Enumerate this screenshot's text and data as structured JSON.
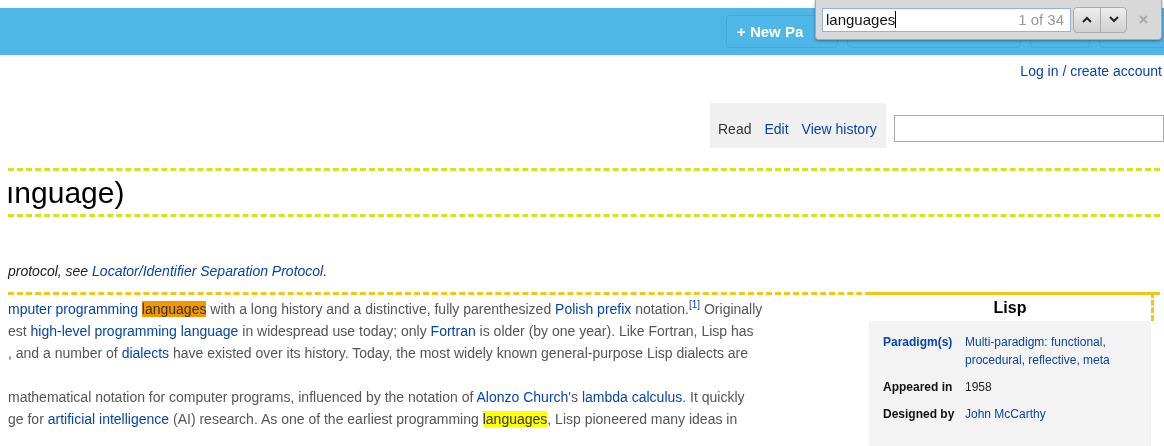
{
  "toolbar": {
    "new_button": "+ New Pa"
  },
  "find_bar": {
    "query": "languages",
    "count": "1 of 34"
  },
  "login_link": "Log in / create account",
  "view_tabs": [
    {
      "label": "Read",
      "selected": true
    },
    {
      "label": "Edit",
      "selected": false
    },
    {
      "label": "View history",
      "selected": false
    }
  ],
  "title": "ınguage)",
  "hatnote": [
    {
      "kind": "text",
      "text": "protocol, see "
    },
    {
      "kind": "link",
      "text": "Locator/Identifier Separation Protocol"
    },
    {
      "kind": "text",
      "text": "."
    }
  ],
  "paragraphs": [
    [
      [
        {
          "kind": "link",
          "text": "mputer programming "
        },
        {
          "kind": "current_match",
          "text": "languages"
        },
        {
          "kind": "text",
          "text": " with a long history and a distinctive, fully parenthesized "
        },
        {
          "kind": "link",
          "text": "Polish prefix"
        },
        {
          "kind": "text",
          "text": " notation."
        },
        {
          "kind": "ref",
          "text": "[1]"
        },
        {
          "kind": "text",
          "text": " Originally"
        }
      ],
      [
        {
          "kind": "text",
          "text": "est "
        },
        {
          "kind": "link",
          "text": "high-level programming language"
        },
        {
          "kind": "text",
          "text": " in widespread use today; only "
        },
        {
          "kind": "link",
          "text": "Fortran"
        },
        {
          "kind": "text",
          "text": " is older (by one year). Like Fortran, Lisp has"
        }
      ],
      [
        {
          "kind": "text",
          "text": ", and a number of "
        },
        {
          "kind": "link",
          "text": "dialects"
        },
        {
          "kind": "text",
          "text": " have existed over its history. Today, the most widely known general-purpose Lisp dialects are"
        }
      ]
    ],
    [
      [
        {
          "kind": "text",
          "text": "mathematical notation for computer programs, influenced by the notation of "
        },
        {
          "kind": "link",
          "text": "Alonzo Church"
        },
        {
          "kind": "text",
          "text": "'s "
        },
        {
          "kind": "link",
          "text": "lambda calculus"
        },
        {
          "kind": "text",
          "text": ". It quickly"
        }
      ],
      [
        {
          "kind": "text",
          "text": "ge for "
        },
        {
          "kind": "link",
          "text": "artificial intelligence"
        },
        {
          "kind": "text",
          "text": " (AI) research. As one of the earliest programming "
        },
        {
          "kind": "match",
          "text": "languages"
        },
        {
          "kind": "text",
          "text": ", Lisp pioneered many ideas in"
        }
      ]
    ]
  ],
  "infobox": {
    "title": "Lisp",
    "rows": [
      {
        "label": "Paradigm(s)",
        "label_link": true,
        "value": "Multi-paradigm: functional, procedural, reflective, meta",
        "value_link": true
      },
      {
        "label": "Appeared in",
        "label_link": false,
        "value": "1958",
        "value_link": false
      },
      {
        "label": "Designed by",
        "label_link": false,
        "value": "John McCarthy",
        "value_link": true
      }
    ]
  }
}
